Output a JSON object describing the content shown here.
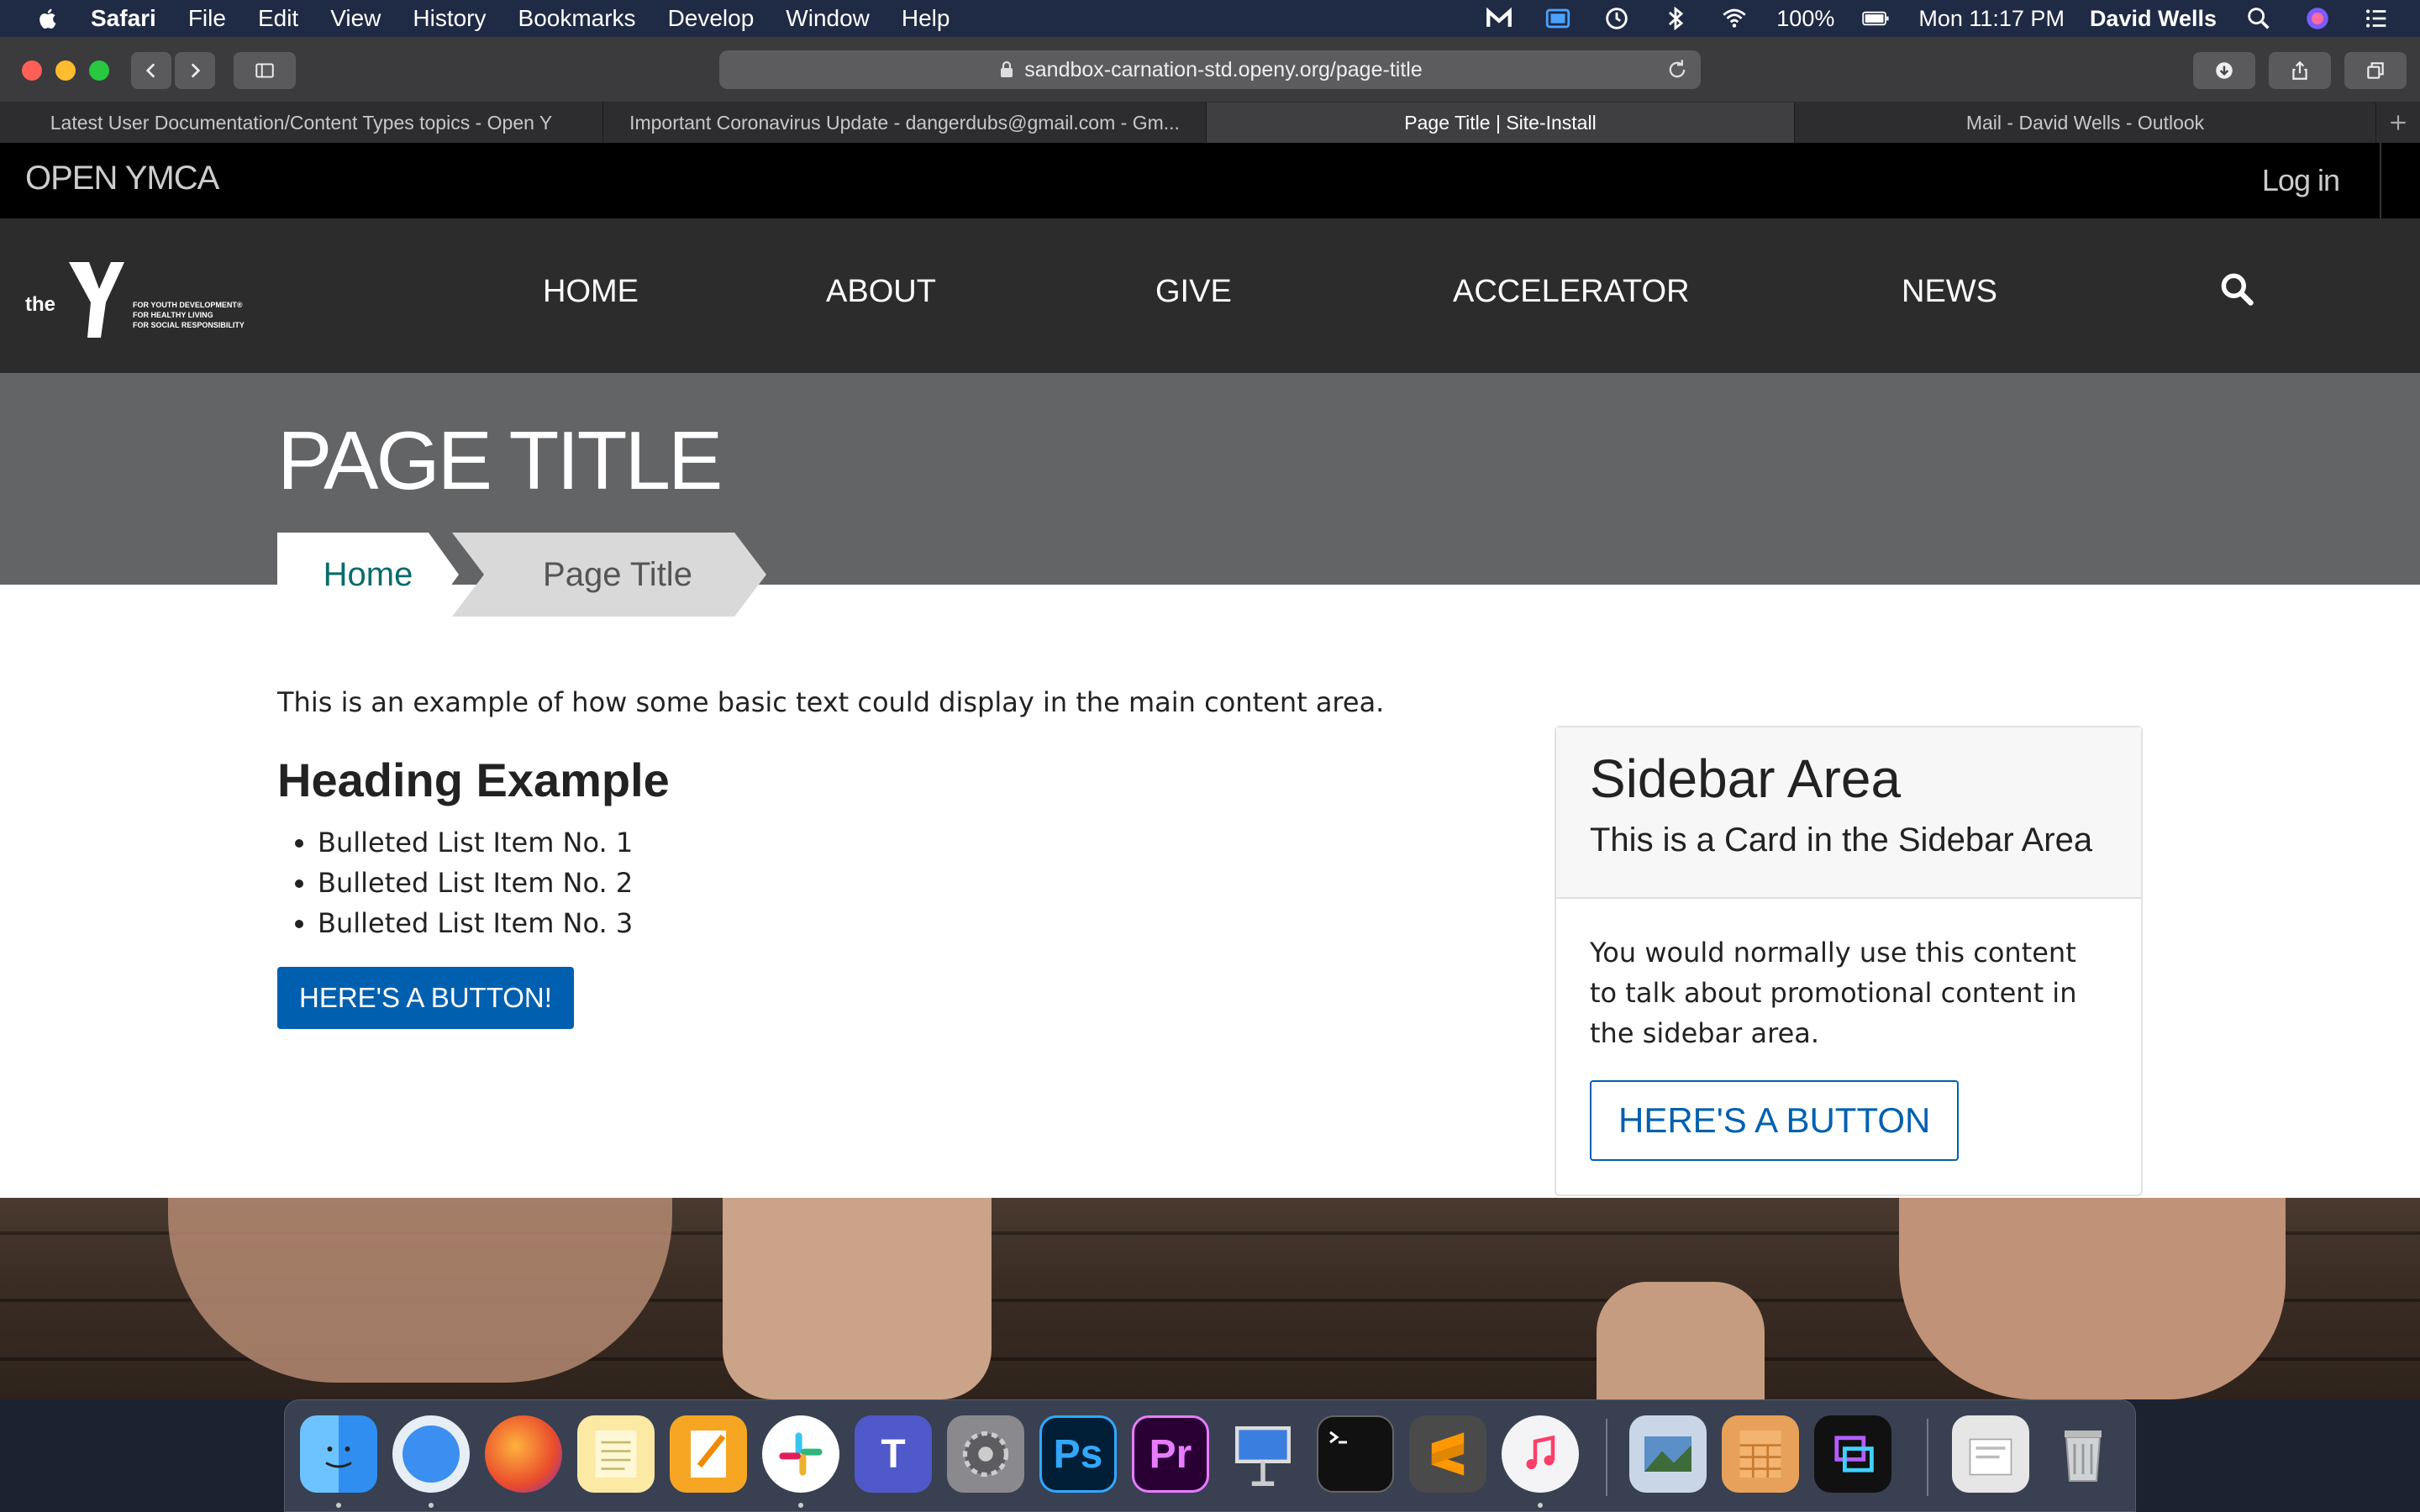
{
  "menubar": {
    "app_name": "Safari",
    "menus": [
      "File",
      "Edit",
      "View",
      "History",
      "Bookmarks",
      "Develop",
      "Window",
      "Help"
    ],
    "battery": "100%",
    "clock": "Mon 11:17 PM",
    "user": "David Wells"
  },
  "browser": {
    "url": "sandbox-carnation-std.openy.org/page-title",
    "tabs": [
      {
        "label": "Latest User Documentation/Content Types topics - Open Y",
        "active": false
      },
      {
        "label": "Important Coronavirus Update - dangerdubs@gmail.com - Gm...",
        "active": false
      },
      {
        "label": "Page Title | Site-Install",
        "active": true
      },
      {
        "label": "Mail - David Wells - Outlook",
        "active": false
      }
    ]
  },
  "site": {
    "name": "OPEN YMCA",
    "login_label": "Log in",
    "logo": {
      "the": "the",
      "y": "Y",
      "tag1": "FOR YOUTH DEVELOPMENT®",
      "tag2": "FOR HEALTHY LIVING",
      "tag3": "FOR SOCIAL RESPONSIBILITY"
    },
    "nav": [
      "HOME",
      "ABOUT",
      "GIVE",
      "ACCELERATOR",
      "NEWS"
    ],
    "page_title": "PAGE TITLE",
    "breadcrumb": {
      "home": "Home",
      "current": "Page Title"
    },
    "main": {
      "intro": "This is an example of how some basic text could display in the main content area.",
      "heading": "Heading Example",
      "bullets": [
        "Bulleted List Item No. 1",
        "Bulleted List Item No. 2",
        "Bulleted List Item No. 3"
      ],
      "button": "HERE'S A BUTTON!"
    },
    "sidebar": {
      "title": "Sidebar Area",
      "subtitle": "This is a Card in the Sidebar Area",
      "body": "You would normally use this content to talk about promotional content in the sidebar area.",
      "button": "HERE'S A BUTTON"
    }
  },
  "colors": {
    "brand_blue": "#0060af",
    "breadcrumb_link": "#0a6b6b",
    "hero_gray": "#636466",
    "nav_dark": "#2c2c2c"
  },
  "dock": {
    "apps": [
      "finder-icon",
      "safari-icon",
      "firefox-icon",
      "notes-icon",
      "pages-icon",
      "slack-icon",
      "teams-icon",
      "system-preferences-icon",
      "photoshop-icon",
      "premiere-icon",
      "keynote-icon",
      "terminal-icon",
      "sublime-text-icon",
      "itunes-icon",
      "preview-icon",
      "calculator-icon",
      "screen-capture-icon",
      "documents-stack-icon",
      "trash-icon"
    ],
    "ps_label": "Ps",
    "pr_label": "Pr"
  }
}
